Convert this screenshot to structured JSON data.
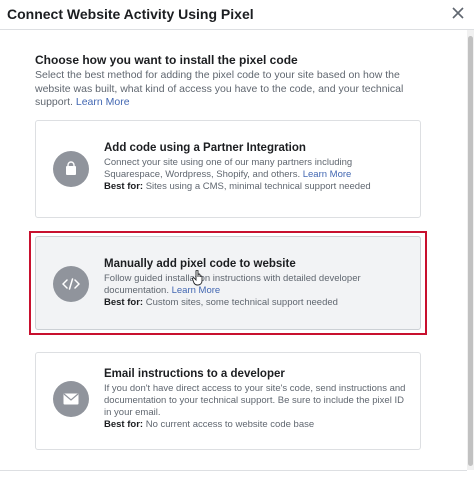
{
  "dialog": {
    "title": "Connect Website Activity Using Pixel",
    "close_icon": "close-x-icon"
  },
  "intro": {
    "heading": "Choose how you want to install the pixel code",
    "description": "Select the best method for adding the pixel code to your site based on how the website was built, what kind of access you have to the code, and your technical support.",
    "learn_more": "Learn More"
  },
  "options": [
    {
      "icon": "shopping-bag-icon",
      "title": "Add code using a Partner Integration",
      "description": "Connect your site using one of our many partners including Squarespace, Wordpress, Shopify, and others.",
      "learn_more": "Learn More",
      "best_for_label": "Best for:",
      "best_for_text": "Sites using a CMS, minimal technical support needed",
      "selected": false
    },
    {
      "icon": "code-icon",
      "title": "Manually add pixel code to website",
      "description": "Follow guided installation instructions with detailed developer documentation.",
      "learn_more": "Learn More",
      "best_for_label": "Best for:",
      "best_for_text": "Custom sites, some technical support needed",
      "selected": true
    },
    {
      "icon": "envelope-icon",
      "title": "Email instructions to a developer",
      "description": "If you don't have direct access to your site's code, send instructions and documentation to your technical support. Be sure to include the pixel ID in your email.",
      "learn_more": "",
      "best_for_label": "Best for:",
      "best_for_text": "No current access to website code base",
      "selected": false
    }
  ],
  "colors": {
    "highlight": "#c8102e",
    "link": "#4267b2",
    "icon_bg": "#90949c"
  }
}
